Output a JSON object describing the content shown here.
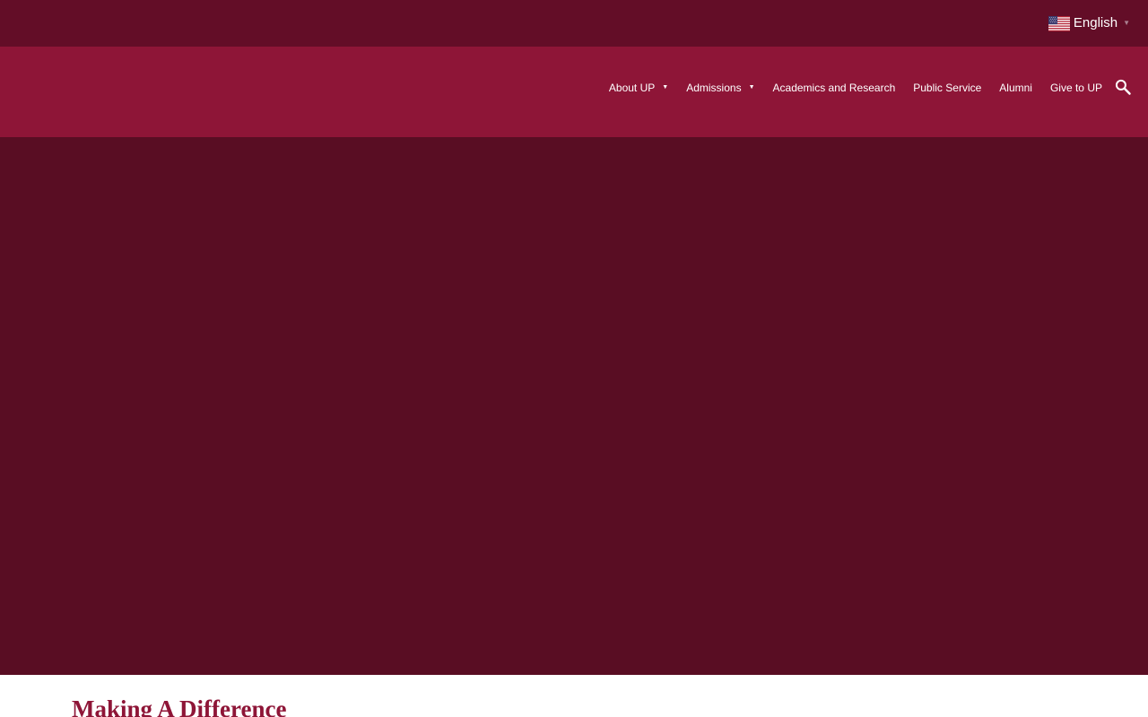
{
  "language_selector": {
    "label": "English",
    "flag_icon": "us-flag-icon",
    "caret": "▼"
  },
  "nav": {
    "items": [
      {
        "label": "About UP",
        "has_dropdown": true
      },
      {
        "label": "Admissions",
        "has_dropdown": true
      },
      {
        "label": "Academics and Research",
        "has_dropdown": false
      },
      {
        "label": "Public Service",
        "has_dropdown": false
      },
      {
        "label": "Alumni",
        "has_dropdown": false
      },
      {
        "label": "Give to UP",
        "has_dropdown": false
      }
    ],
    "caret": "▼",
    "search_icon": "search-icon"
  },
  "main": {
    "heading": "Making A Difference"
  },
  "colors": {
    "topbar": "#630d27",
    "navbar": "#8e1537",
    "hero": "#590d23",
    "heading": "#8e1537"
  }
}
